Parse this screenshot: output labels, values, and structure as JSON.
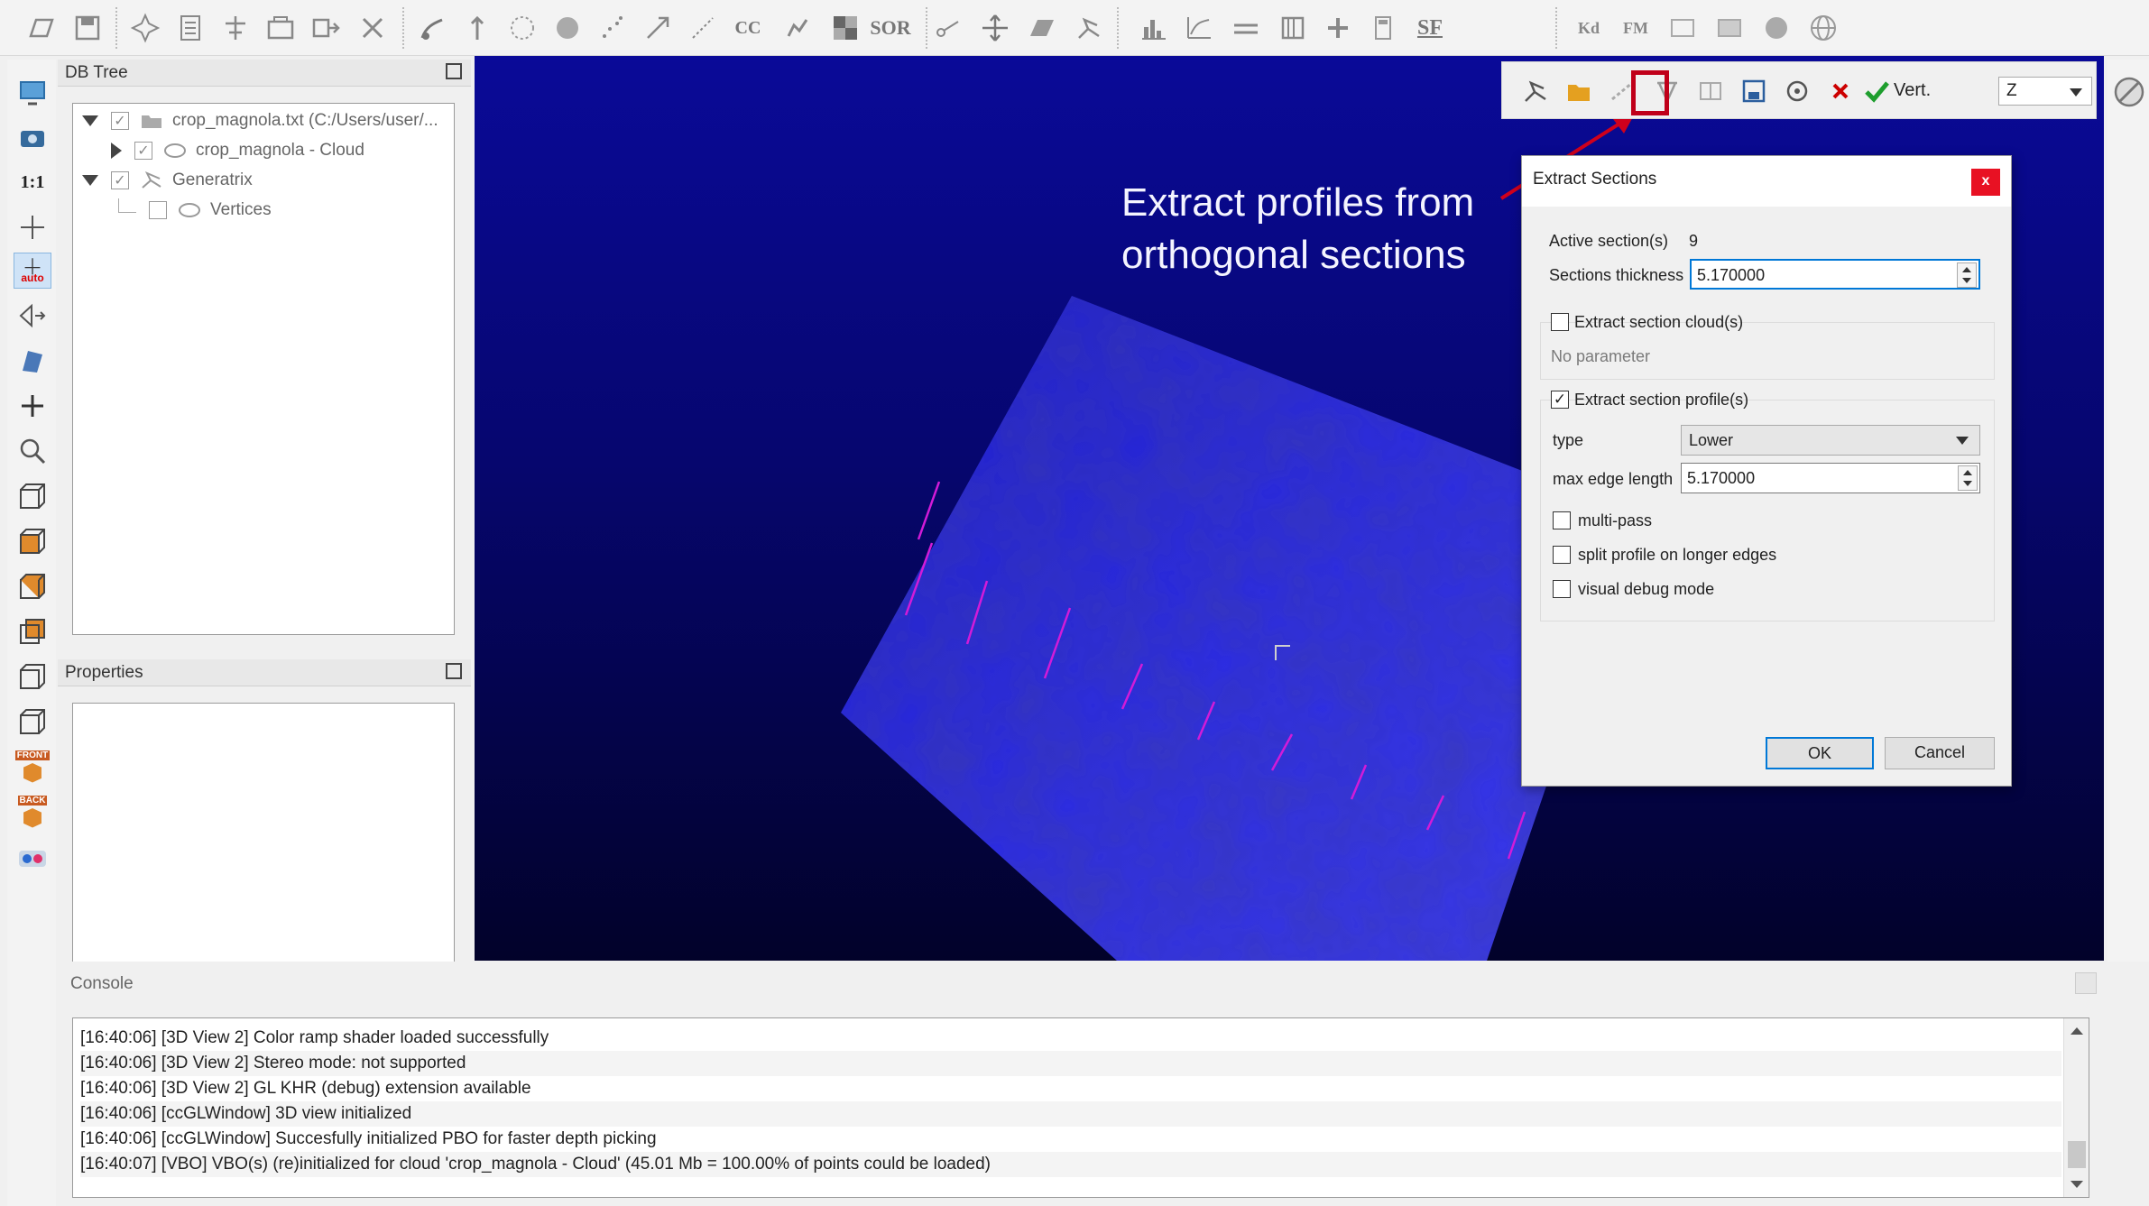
{
  "toolbar": {
    "text_buttons": {
      "cc": "CC",
      "sor": "SOR",
      "sf": "SF",
      "kd": "Kd",
      "fm": "FM"
    }
  },
  "left_tools": {
    "one_to_one": "1:1",
    "auto": "auto",
    "front": "FRONT",
    "back": "BACK"
  },
  "db_tree": {
    "title": "DB Tree",
    "items": [
      {
        "label": "crop_magnola.txt (C:/Users/user/...",
        "checked": true,
        "expanded": true
      },
      {
        "label": "crop_magnola - Cloud",
        "checked": true,
        "expanded": false
      },
      {
        "label": "Generatrix",
        "checked": true,
        "expanded": true
      },
      {
        "label": "Vertices",
        "checked": false
      }
    ]
  },
  "properties": {
    "title": "Properties"
  },
  "section_toolbar": {
    "vert_label": "Vert.",
    "axis_value": "Z"
  },
  "annotation": {
    "line1": "Extract profiles from",
    "line2": "orthogonal sections"
  },
  "dialog": {
    "title": "Extract Sections",
    "close": "x",
    "active_sections_label": "Active section(s)",
    "active_sections_value": "9",
    "thickness_label": "Sections thickness",
    "thickness_value": "5.170000",
    "extract_cloud_label": "Extract section cloud(s)",
    "extract_cloud_checked": false,
    "no_parameter": "No parameter",
    "extract_profile_label": "Extract section profile(s)",
    "extract_profile_checked": true,
    "type_label": "type",
    "type_value": "Lower",
    "max_edge_label": "max edge length",
    "max_edge_value": "5.170000",
    "multipass_label": "multi-pass",
    "split_label": "split profile on longer edges",
    "debug_label": "visual debug mode",
    "ok": "OK",
    "cancel": "Cancel"
  },
  "console": {
    "title": "Console",
    "lines": [
      "[16:40:06] [3D View 2] Color ramp shader loaded successfully",
      "[16:40:06] [3D View 2] Stereo mode: not supported",
      "[16:40:06] [3D View 2] GL KHR (debug) extension available",
      "[16:40:06] [ccGLWindow] 3D view initialized",
      "[16:40:06] [ccGLWindow] Succesfully initialized PBO for faster depth picking",
      "[16:40:07] [VBO] VBO(s) (re)initialized for cloud 'crop_magnola - Cloud' (45.01 Mb = 100.00% of points could be loaded)"
    ]
  },
  "colors": {
    "highlight": "#c0001a",
    "cloud": "#2424e0",
    "profiles": "#d21bd8",
    "background_top": "#0a0a98"
  }
}
